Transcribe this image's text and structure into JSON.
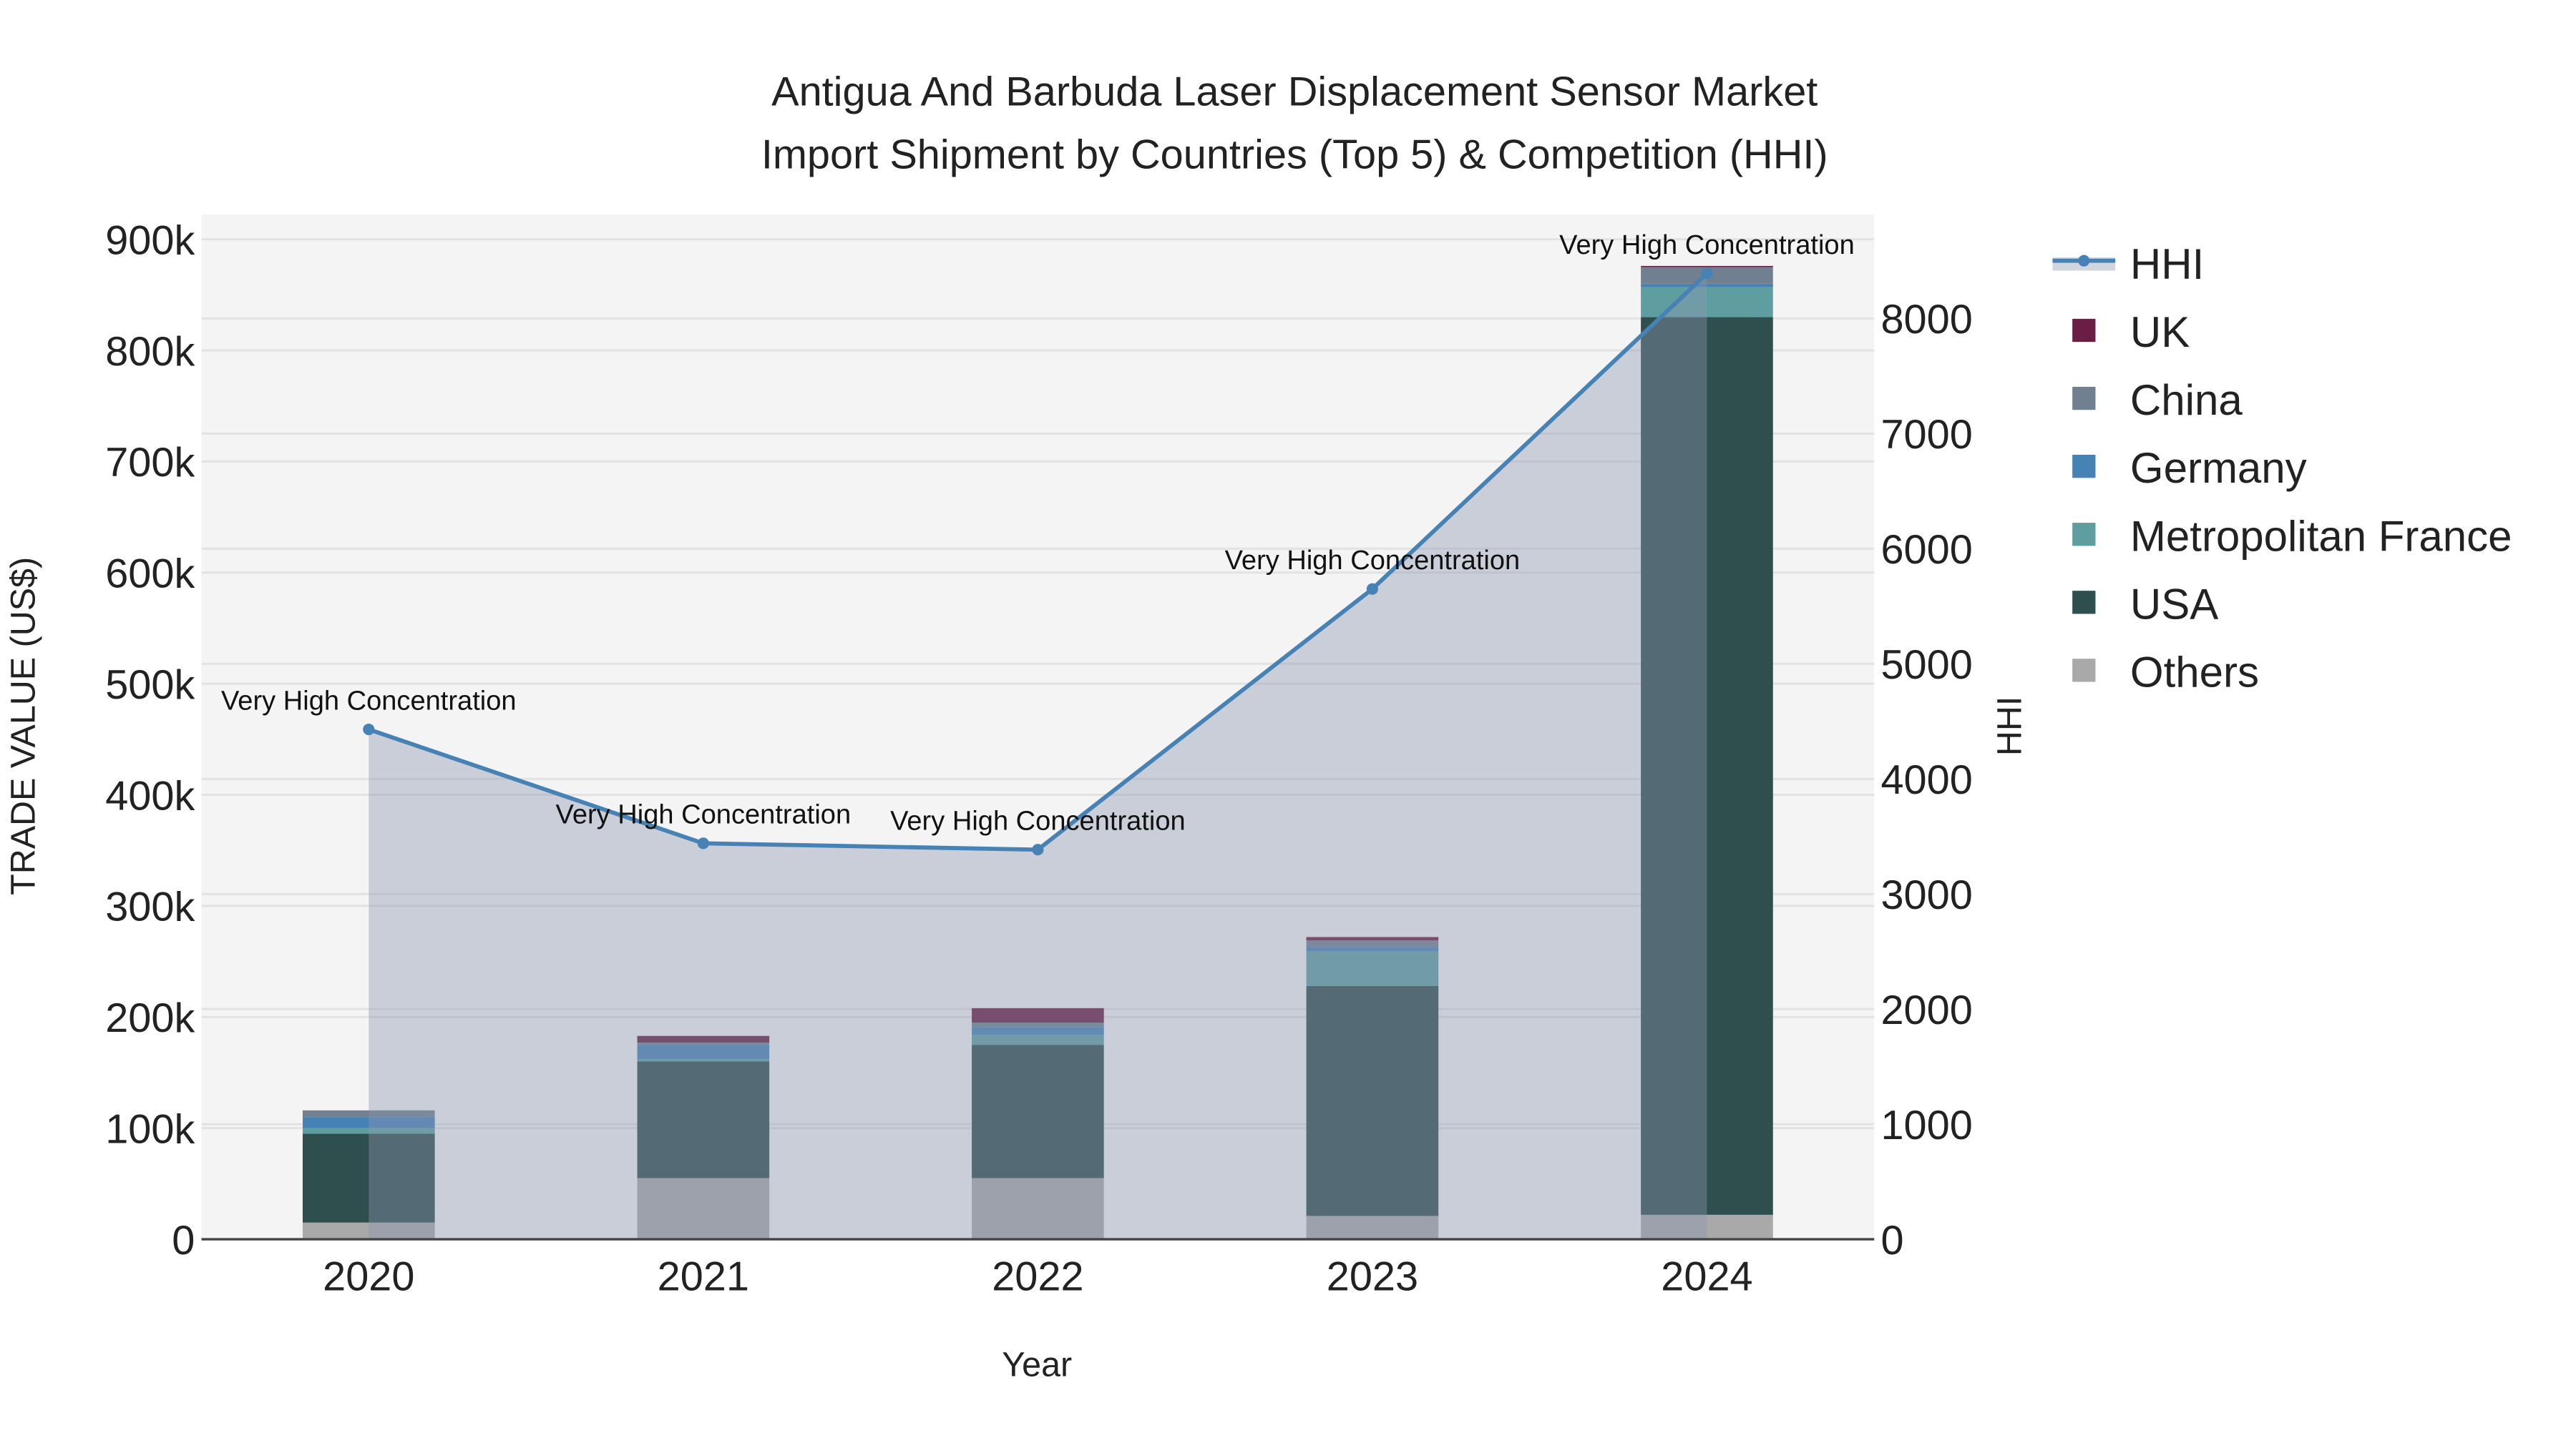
{
  "chart_data": {
    "type": "bar",
    "title": "Antigua And Barbuda Laser Displacement Sensor Market",
    "subtitle": "Import Shipment by Countries (Top 5) & Competition (HHI)",
    "xlabel": "Year",
    "ylabel": "TRADE VALUE (US$)",
    "y2label": "HHI",
    "categories": [
      "2020",
      "2021",
      "2022",
      "2023",
      "2024"
    ],
    "ylim": [
      0,
      900000
    ],
    "y2lim": [
      0,
      8700
    ],
    "yticks": [
      0,
      100000,
      200000,
      300000,
      400000,
      500000,
      600000,
      700000,
      800000,
      900000
    ],
    "ytick_labels": [
      "0",
      "100k",
      "200k",
      "300k",
      "400k",
      "500k",
      "600k",
      "700k",
      "800k",
      "900k"
    ],
    "y2ticks": [
      0,
      1000,
      2000,
      3000,
      4000,
      5000,
      6000,
      7000,
      8000
    ],
    "y2tick_labels": [
      "0",
      "1000",
      "2000",
      "3000",
      "4000",
      "5000",
      "6000",
      "7000",
      "8000"
    ],
    "stacked": true,
    "series": [
      {
        "name": "Others",
        "color": "#A9A9A9",
        "values": [
          15000,
          55000,
          55000,
          21000,
          22000
        ]
      },
      {
        "name": "USA",
        "color": "#2F4F4F",
        "values": [
          80000,
          105000,
          120000,
          207000,
          808000
        ]
      },
      {
        "name": "Metropolitan France",
        "color": "#5F9EA0",
        "values": [
          5000,
          2000,
          9000,
          31000,
          27000
        ]
      },
      {
        "name": "Germany",
        "color": "#4682B4",
        "values": [
          10000,
          13000,
          7000,
          4000,
          3000
        ]
      },
      {
        "name": "China",
        "color": "#708090",
        "values": [
          6000,
          2000,
          4000,
          6000,
          15000
        ]
      },
      {
        "name": "UK",
        "color": "#6B1E45",
        "values": [
          0,
          6000,
          13000,
          3000,
          1000
        ]
      }
    ],
    "hhi": {
      "name": "HHI",
      "color": "#4682B4",
      "values": [
        4430,
        3440,
        3385,
        5650,
        8390
      ],
      "annotations": [
        "Very High Concentration",
        "Very High Concentration",
        "Very High Concentration",
        "Very High Concentration",
        "Very High Concentration"
      ]
    },
    "legend_order": [
      "HHI",
      "UK",
      "China",
      "Germany",
      "Metropolitan France",
      "USA",
      "Others"
    ],
    "legend_placement": "right",
    "grid": true
  }
}
